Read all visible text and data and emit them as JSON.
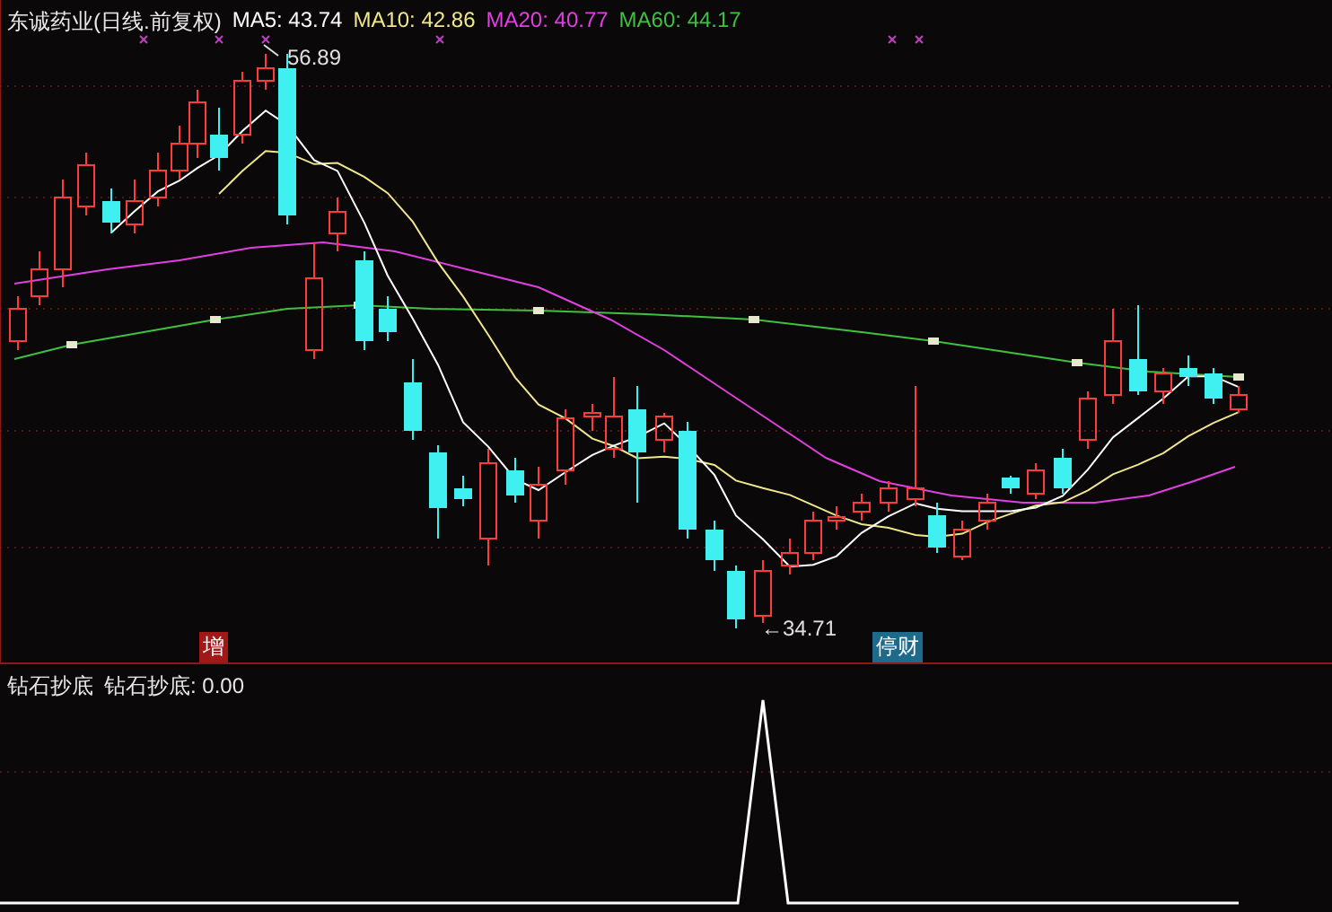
{
  "header": {
    "stock": "东诚药业(日线.前复权)",
    "ma": [
      {
        "label": "MA5: 43.74",
        "color": "#ffffff"
      },
      {
        "label": "MA10: 42.86",
        "color": "#f0e68c"
      },
      {
        "label": "MA20: 40.77",
        "color": "#e040e0"
      },
      {
        "label": "MA60: 44.17",
        "color": "#40c040"
      }
    ]
  },
  "price_labels": [
    {
      "text": "56.89",
      "kind": "high"
    },
    {
      "text": "←34.71",
      "kind": "low"
    }
  ],
  "markers": [
    {
      "text": "增",
      "color": "#a01818"
    },
    {
      "text": "停财",
      "color": "#1e6a8a"
    }
  ],
  "indicator": {
    "name": "钻石抄底",
    "reading": "钻石抄底: 0.00"
  }
}
